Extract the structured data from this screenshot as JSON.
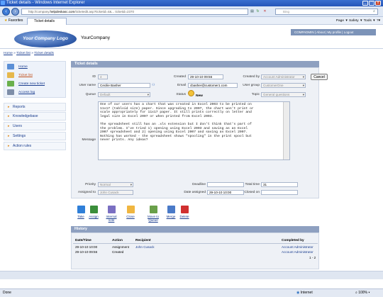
{
  "window": {
    "title": "Ticket details - Windows Internet Explorer"
  },
  "browser": {
    "url_prefix": "http://company.",
    "url_host": "helpdeskasc.com",
    "url_rest": "/ticketedit.asp?ticketid=4&... ticketid=2370",
    "search_placeholder": "Bing",
    "favorites_label": "Favorites",
    "tab_label": "Ticket details",
    "tools": "Page ▾  Safety ▾  Tools ▾  ?▾"
  },
  "header": {
    "logo_text": "Your Company Logo",
    "company_name": "YourCompany",
    "topnav": "COMPADMIN | About | My profile | Logout"
  },
  "breadcrumb": {
    "home": "Home",
    "ticket_list": "Ticket list",
    "ticket_details": "Ticket details"
  },
  "sidebar": {
    "items": [
      {
        "label": "Home"
      },
      {
        "label": "Ticket list"
      },
      {
        "label": "Create new ticket"
      },
      {
        "label": "Access log"
      }
    ],
    "sections": [
      "Reports",
      "Knowledgebase",
      "Users",
      "Settings",
      "Action rules"
    ]
  },
  "ticket": {
    "panel_title": "Ticket details",
    "labels": {
      "id": "ID",
      "user_name": "User name",
      "queue": "Queue",
      "message": "Message",
      "created": "Created",
      "email": "Email",
      "status": "Status",
      "created_by": "Created by",
      "user_group": "User group",
      "topic": "Topic",
      "priority": "Priority",
      "assigned_to": "Assigned to",
      "deadline": "Deadline",
      "date_assigned": "Date assigned",
      "total_time": "Total time",
      "closed_on": "Closed on"
    },
    "values": {
      "id": "4",
      "user_name": "Cecilie Basher",
      "queue": "Default",
      "created": "29-10-10 09:56",
      "email": "cbasher@customer1.com",
      "status": "New",
      "created_by": "Account Administrator",
      "user_group": "CustomerOne",
      "topic": "General questions",
      "priority": "Normal",
      "assigned_to": "John Cusack",
      "deadline": "",
      "date_assigned": "29-10-10 10:00",
      "total_time": "31",
      "closed_on": ""
    },
    "message": "One of our users has a chart that was created in Excel 2003 to be printed on\n11x17 (tabloid size) paper. Since upgrading to 2007, the chart won't print or\nscale appropriately for 11x17 paper. It still prints correctly on letter and\nlegal size in Excel 2007 or when printed from Excel 2003.\n\nThe spreadsheet still has an .xls extension but I don't think that's part of\nthe problem. I've tried 1) opening using Excel 2003 and saving as an Excel\n2007 spreadsheet and 2) opening using Excel 2007 and saving as Excel 2007.\nNothing has worked - the spreadsheet shows \"spooling\" in the print spool but\nnever prints. Any ideas?",
    "cancel_label": "Cancel"
  },
  "actions": [
    {
      "label": "Take",
      "color": "#2f7fd8"
    },
    {
      "label": "Assign",
      "color": "#3b8e3b"
    },
    {
      "label": "Internal note",
      "color": "#7a6fc2"
    },
    {
      "label": "Close",
      "color": "#f0b640"
    },
    {
      "label": "Move to Queue",
      "color": "#6aa04a"
    },
    {
      "label": "Merge",
      "color": "#4a7ac8"
    },
    {
      "label": "Delete",
      "color": "#d03030"
    }
  ],
  "history": {
    "title": "History",
    "columns": [
      "Date/Time",
      "Action",
      "Recipient",
      "Completed by"
    ],
    "rows": [
      {
        "datetime": "29-10-10 10:00",
        "action": "Assignment",
        "recipient": "John Cusack",
        "completed_by": "Account Administrator"
      },
      {
        "datetime": "29-10-10 09:56",
        "action": "Created",
        "recipient": "",
        "completed_by": "Account Administrator"
      }
    ],
    "pager": "1 - 2"
  },
  "statusbar": {
    "left": "Done",
    "zone": "Internet",
    "zoom": "100%"
  }
}
